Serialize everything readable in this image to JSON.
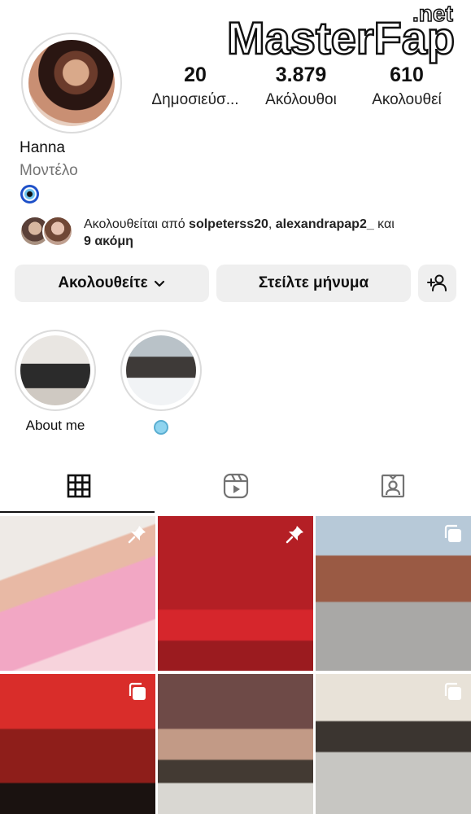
{
  "watermark": {
    "text_main": "MasterFap",
    "text_suffix": ".net"
  },
  "profile": {
    "name": "Hanna",
    "category": "Μοντέλο",
    "bio_icon": "nazar-amulet-icon"
  },
  "stats": [
    {
      "value": "20",
      "label": "Δημοσιεύσ..."
    },
    {
      "value": "3.879",
      "label": "Ακόλουθοι"
    },
    {
      "value": "610",
      "label": "Ακολουθεί"
    }
  ],
  "followed_by": {
    "prefix": "Ακολουθείται από ",
    "user1": "solpeterss20",
    "separator": ", ",
    "user2": "alexandrapap2_",
    "conj": " και",
    "more": "9 ακόμη"
  },
  "actions": {
    "follow_label": "Ακολουθείτε",
    "message_label": "Στείλτε μήνυμα",
    "add_user_icon": "add-user-icon"
  },
  "highlights": [
    {
      "label": "About me"
    },
    {
      "label": "",
      "emoji": "cold-face-emoji"
    }
  ],
  "tabs": [
    {
      "icon": "grid-icon",
      "active": true
    },
    {
      "icon": "reels-icon",
      "active": false
    },
    {
      "icon": "tagged-icon",
      "active": false
    }
  ],
  "posts": [
    {
      "overlay_icon": "pin-icon"
    },
    {
      "overlay_icon": "pin-icon"
    },
    {
      "overlay_icon": "carousel-icon"
    },
    {
      "overlay_icon": "carousel-icon"
    },
    {
      "overlay_icon": ""
    },
    {
      "overlay_icon": "carousel-icon"
    }
  ],
  "colors": {
    "button_bg": "#efefef",
    "secondary_text": "#737373",
    "border": "#dbdbdb"
  }
}
